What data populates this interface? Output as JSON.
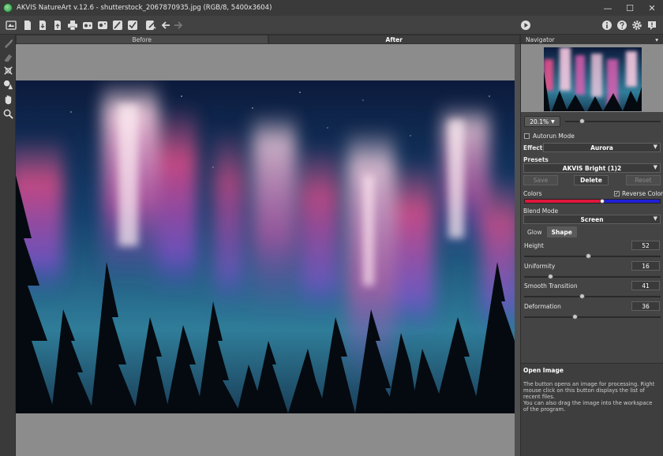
{
  "window": {
    "title": "AKVIS NatureArt v.12.6 - shutterstock_2067870935.jpg (RGB/8, 5400x3604)",
    "controls": [
      "—",
      "☐",
      "✕"
    ]
  },
  "workspace": {
    "tabs": [
      {
        "label": "Before",
        "active": false
      },
      {
        "label": "After",
        "active": true
      }
    ]
  },
  "navigator": {
    "title": "Navigator",
    "menu_glyph": "▾",
    "zoom": "20.1%",
    "zoom_level": 0.16
  },
  "settings": {
    "autorun_label": "Autorun Mode",
    "autorun_checked": false,
    "effect_label": "Effect:",
    "effect_value": "Aurora",
    "presets_label": "Presets",
    "preset_value": "AKVIS Bright (1)2",
    "buttons": {
      "save": "Save",
      "delete": "Delete",
      "reset": "Reset"
    },
    "colors_label": "Colors",
    "reverse_colors_label": "Reverse Colors",
    "reverse_colors_checked": true,
    "color_left": "#e0163c",
    "color_right": "#1f1fd6",
    "color_split": 0.57,
    "blend_mode_label": "Blend Mode",
    "blend_mode_value": "Screen",
    "subtabs": [
      {
        "label": "Glow",
        "active": false
      },
      {
        "label": "Shape",
        "active": true
      }
    ],
    "params": [
      {
        "label": "Height",
        "value": "52",
        "fraction": 0.47
      },
      {
        "label": "Uniformity",
        "value": "16",
        "fraction": 0.18
      },
      {
        "label": "Smooth Transition",
        "value": "41",
        "fraction": 0.42
      },
      {
        "label": "Deformation",
        "value": "36",
        "fraction": 0.37
      }
    ]
  },
  "help": {
    "title": "Open Image",
    "text": "The button opens an image for processing. Right mouse click on this button displays the list of recent files.\nYou can also drag the image into the workspace of the program."
  },
  "toolbar_icons": [
    "home-icon",
    "open-image-icon",
    "save-image-icon",
    "export-icon",
    "print-icon",
    "batch-icon",
    "share-icon",
    "brush-preset-icon",
    "check-icon",
    "edit-icon",
    "undo-icon",
    "redo-icon",
    "run-icon",
    "info-icon",
    "help-icon",
    "settings-icon",
    "notification-icon"
  ]
}
